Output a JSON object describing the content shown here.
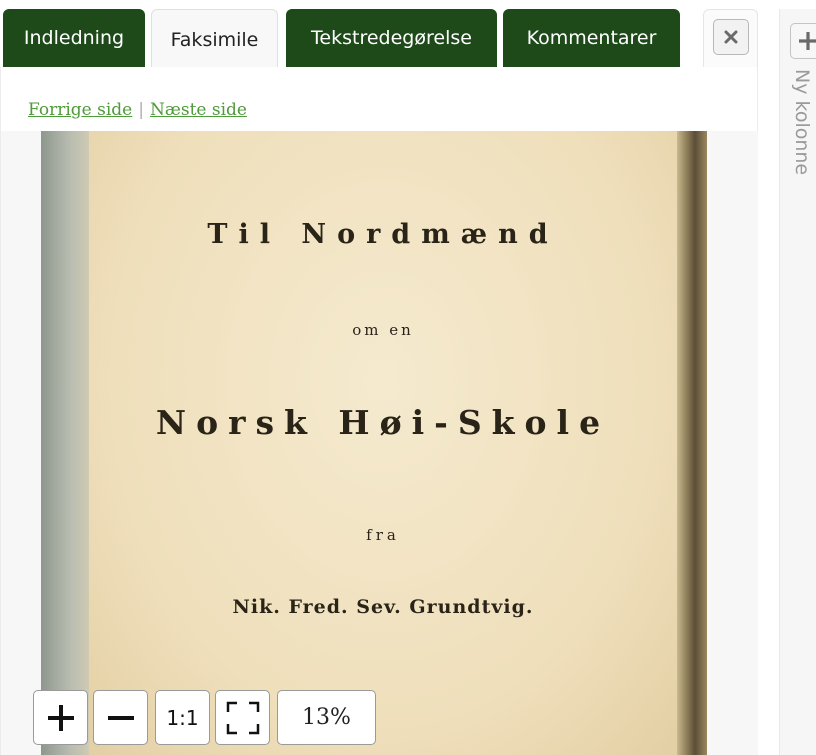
{
  "tabs": [
    {
      "label": "Indledning",
      "active": false
    },
    {
      "label": "Faksimile",
      "active": true
    },
    {
      "label": "Tekstredegørelse",
      "active": false
    },
    {
      "label": "Kommentarer",
      "active": false
    }
  ],
  "pager": {
    "prev_label": "Forrige side",
    "separator": "|",
    "next_label": "Næste side"
  },
  "facsimile": {
    "line1": "Til Nordmænd",
    "line2": "om en",
    "line3": "Norsk Høi-Skole",
    "line4": "fra",
    "line5": "Nik. Fred. Sev. Grundtvig."
  },
  "zoom": {
    "in_label": "+",
    "out_label": "—",
    "reset_label": "1:1",
    "level": "13%"
  },
  "new_column": {
    "label": "Ny kolonne"
  },
  "colors": {
    "tab_dark": "#1e4a1a",
    "link": "#4f9a3a"
  },
  "icons": [
    "close-icon",
    "plus-icon",
    "fullscreen-icon"
  ]
}
